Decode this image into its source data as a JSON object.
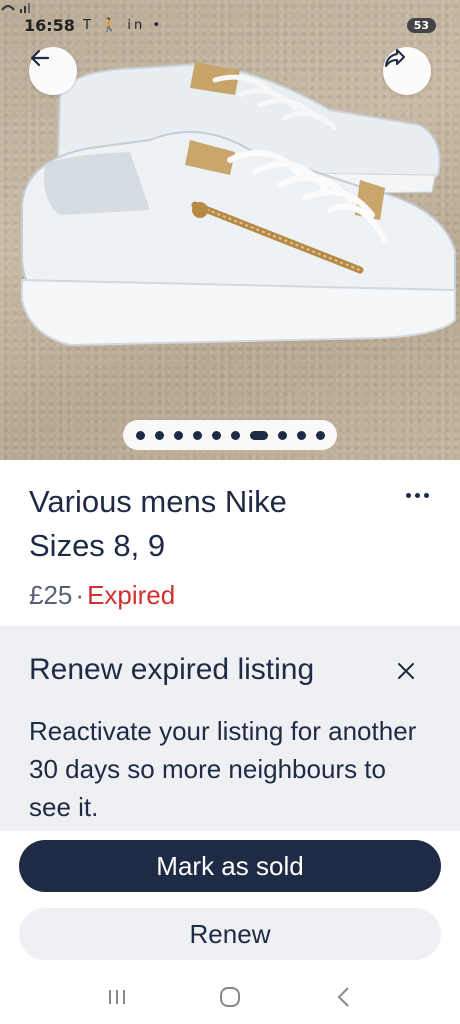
{
  "status_bar": {
    "time": "16:58",
    "icons_left": "T 🚶 in •",
    "battery": "53"
  },
  "photo": {
    "page_count": 10,
    "active_page": 7
  },
  "listing": {
    "title_line1": "Various mens Nike",
    "title_line2": "Sizes 8, 9",
    "price": "£25",
    "separator": "·",
    "status": "Expired"
  },
  "banner": {
    "title": "Renew expired listing",
    "body": "Reactivate your listing for another 30 days so more neighbours to see it."
  },
  "actions": {
    "mark_sold": "Mark as sold",
    "renew": "Renew"
  },
  "colors": {
    "brand_navy": "#1f2a44",
    "expired_red": "#d0302f",
    "banner_bg": "#eef0f4"
  }
}
